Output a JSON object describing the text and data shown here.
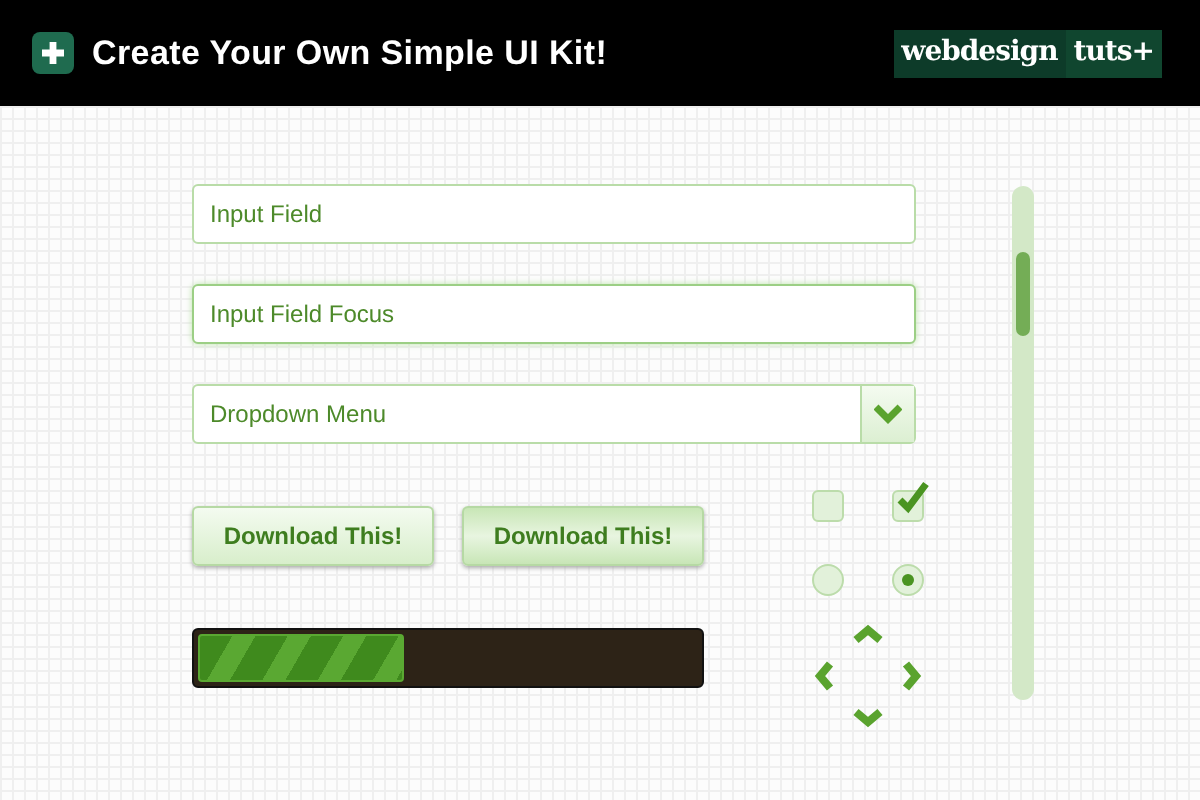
{
  "header": {
    "title": "Create Your Own Simple UI Kit!",
    "logo": {
      "word": "webdesign",
      "suffix": "tuts+"
    }
  },
  "fields": [
    {
      "kind": "input",
      "value": "Input Field",
      "focused": false
    },
    {
      "kind": "input",
      "value": "Input Field Focus",
      "focused": true
    },
    {
      "kind": "dropdown",
      "value": "Dropdown Menu"
    }
  ],
  "buttons": [
    {
      "label": "Download This!",
      "hovered": false
    },
    {
      "label": "Download This!",
      "hovered": true
    }
  ],
  "progress": {
    "level": 0.41
  },
  "checkboxes": [
    {
      "checked": false
    },
    {
      "checked": true
    }
  ],
  "radios": [
    {
      "selected": false
    },
    {
      "selected": true
    }
  ]
}
